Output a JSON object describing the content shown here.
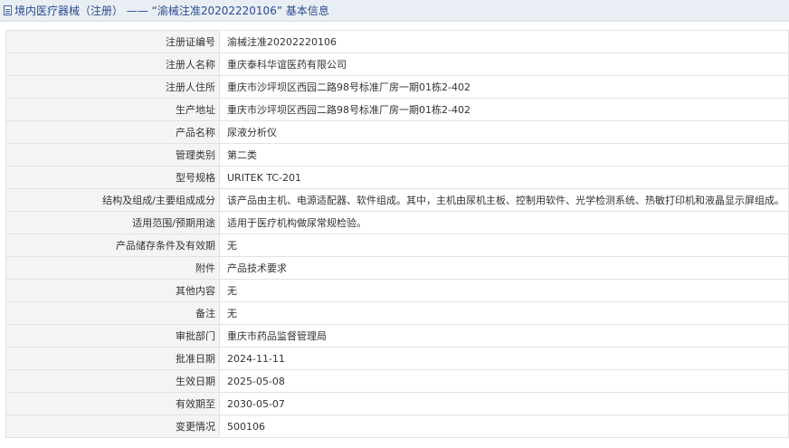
{
  "header": {
    "icon": "document-icon",
    "title": "境内医疗器械（注册） —— “渝械注准20202220106” 基本信息"
  },
  "rows": [
    {
      "label": "注册证编号",
      "value": "渝械注准20202220106"
    },
    {
      "label": "注册人名称",
      "value": "重庆泰科华谊医药有限公司"
    },
    {
      "label": "注册人住所",
      "value": "重庆市沙坪坝区西园二路98号标准厂房一期01栋2-402"
    },
    {
      "label": "生产地址",
      "value": "重庆市沙坪坝区西园二路98号标准厂房一期01栋2-402"
    },
    {
      "label": "产品名称",
      "value": "尿液分析仪"
    },
    {
      "label": "管理类别",
      "value": "第二类"
    },
    {
      "label": "型号规格",
      "value": "URITEK TC-201"
    },
    {
      "label": "结构及组成/主要组成成分",
      "value": "该产品由主机、电源适配器、软件组成。其中，主机由尿机主板、控制用软件、光学检测系统、热敏打印机和液晶显示屏组成。"
    },
    {
      "label": "适用范围/预期用途",
      "value": "适用于医疗机构做尿常规检验。"
    },
    {
      "label": "产品储存条件及有效期",
      "value": "无"
    },
    {
      "label": "附件",
      "value": "产品技术要求"
    },
    {
      "label": "其他内容",
      "value": "无"
    },
    {
      "label": "备注",
      "value": "无"
    },
    {
      "label": "审批部门",
      "value": "重庆市药品监督管理局"
    },
    {
      "label": "批准日期",
      "value": "2024-11-11"
    },
    {
      "label": "生效日期",
      "value": "2025-05-08"
    },
    {
      "label": "有效期至",
      "value": "2030-05-07"
    },
    {
      "label": "变更情况",
      "value": "500106"
    }
  ]
}
